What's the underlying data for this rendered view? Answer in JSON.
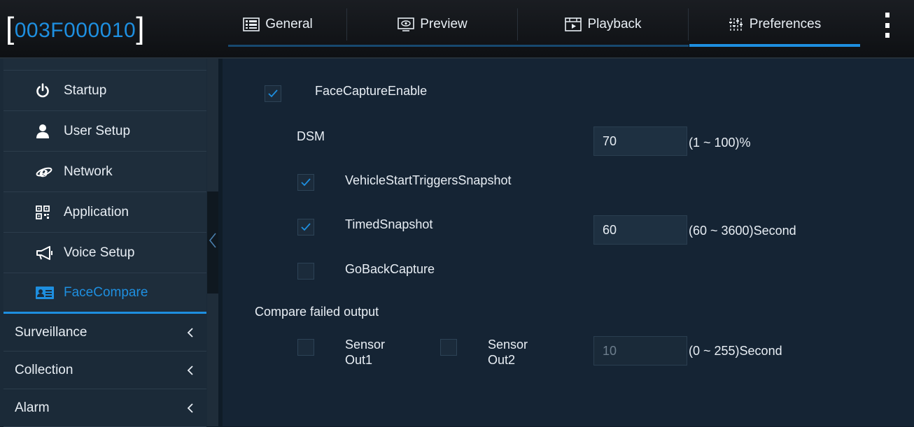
{
  "header": {
    "device_id": "003F000010",
    "bracket_left": "[",
    "bracket_right": "]",
    "tabs": [
      {
        "label": "General",
        "icon": "general-icon"
      },
      {
        "label": "Preview",
        "icon": "preview-icon"
      },
      {
        "label": "Playback",
        "icon": "playback-icon"
      },
      {
        "label": "Preferences",
        "icon": "preferences-icon",
        "active": true
      }
    ]
  },
  "sidebar": {
    "sub_items": [
      {
        "label": "Startup",
        "icon": "power-icon"
      },
      {
        "label": "User Setup",
        "icon": "user-icon"
      },
      {
        "label": "Network",
        "icon": "network-icon"
      },
      {
        "label": "Application",
        "icon": "qr-code-icon"
      },
      {
        "label": "Voice Setup",
        "icon": "megaphone-icon"
      },
      {
        "label": "FaceCompare",
        "icon": "id-card-icon",
        "active": true
      }
    ],
    "main_items": [
      {
        "label": "Surveillance"
      },
      {
        "label": "Collection"
      },
      {
        "label": "Alarm"
      }
    ]
  },
  "form": {
    "face_capture_enable": {
      "label": "FaceCaptureEnable",
      "checked": true
    },
    "dsm": {
      "label": "DSM",
      "value": "70",
      "range": "(1 ~ 100)%"
    },
    "vehicle_start": {
      "label": "VehicleStartTriggersSnapshot",
      "checked": true
    },
    "timed_snapshot": {
      "label": "TimedSnapshot",
      "checked": true,
      "value": "60",
      "range": "(60 ~ 3600)Second"
    },
    "go_back_capture": {
      "label": "GoBackCapture",
      "checked": false
    },
    "compare_failed": {
      "label": "Compare failed output",
      "sensor1_line1": "Sensor",
      "sensor1_line2": "Out1",
      "sensor1_checked": false,
      "sensor2_line1": "Sensor",
      "sensor2_line2": "Out2",
      "sensor2_checked": false,
      "value": "10",
      "range": "(0 ~ 255)Second"
    }
  },
  "colors": {
    "accent": "#1e8fe0",
    "background": "#152434",
    "sidebar": "#1b2a38"
  }
}
